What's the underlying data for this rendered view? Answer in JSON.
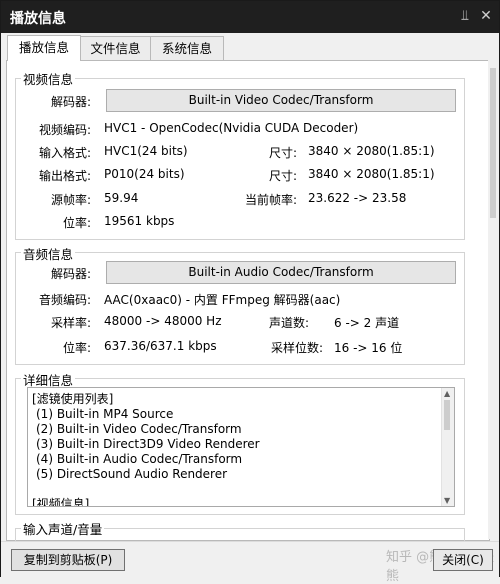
{
  "window": {
    "title": "播放信息",
    "pin_icon": "pin-icon",
    "close_icon": "close-icon"
  },
  "tabs": [
    {
      "label": "播放信息",
      "active": true
    },
    {
      "label": "文件信息",
      "active": false
    },
    {
      "label": "系统信息",
      "active": false
    }
  ],
  "video": {
    "group_title": "视频信息",
    "decoder_label": "解码器:",
    "decoder_button": "Built-in Video Codec/Transform",
    "codec_label": "视频编码:",
    "codec_value": "HVC1 - OpenCodec(Nvidia CUDA Decoder)",
    "input_format_label": "输入格式:",
    "input_format_value": "HVC1(24 bits)",
    "input_size_label": "尺寸:",
    "input_size_value": "3840 × 2080(1.85:1)",
    "output_format_label": "输出格式:",
    "output_format_value": "P010(24 bits)",
    "output_size_label": "尺寸:",
    "output_size_value": "3840 × 2080(1.85:1)",
    "source_fps_label": "源帧率:",
    "source_fps_value": "59.94",
    "current_fps_label": "当前帧率:",
    "current_fps_value": "23.622 -> 23.58",
    "bitrate_label": "位率:",
    "bitrate_value": "19561 kbps"
  },
  "audio": {
    "group_title": "音频信息",
    "decoder_label": "解码器:",
    "decoder_button": "Built-in Audio Codec/Transform",
    "codec_label": "音频编码:",
    "codec_value": "AAC(0xaac0) - 内置 FFmpeg 解码器(aac)",
    "samplerate_label": "采样率:",
    "samplerate_value": "48000 -> 48000 Hz",
    "channels_label": "声道数:",
    "channels_value": "6 -> 2 声道",
    "bitrate_label": "位率:",
    "bitrate_value": "637.36/637.1 kbps",
    "bitdepth_label": "采样位数:",
    "bitdepth_value": "16 -> 16 位"
  },
  "details": {
    "group_title": "详细信息",
    "lines": [
      "[滤镜使用列表]",
      "(1) Built-in MP4 Source",
      "(2) Built-in Video Codec/Transform",
      "(3) Built-in Direct3D9 Video Renderer",
      "(4) Built-in Audio Codec/Transform",
      "(5) DirectSound Audio Renderer",
      "",
      "[视频信息]"
    ]
  },
  "input_channels": {
    "group_title": "输入声道/音量"
  },
  "footer": {
    "copy_button": "复制到剪贴板(P)",
    "close_button": "关闭(C)",
    "watermark": "知乎 @熊大欧不是熊"
  }
}
